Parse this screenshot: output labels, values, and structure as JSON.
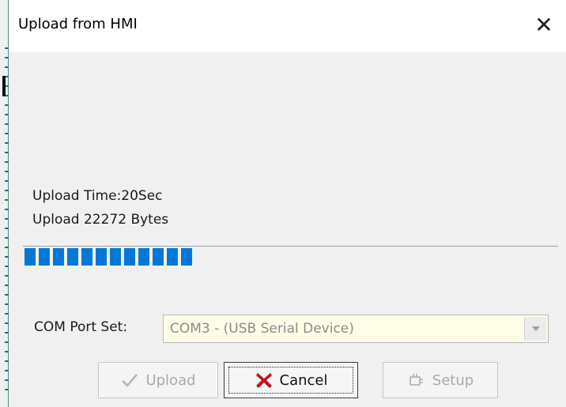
{
  "window": {
    "title": "Upload from HMI",
    "close_glyph": "✕"
  },
  "status": {
    "upload_time": "Upload Time:20Sec",
    "upload_bytes": "Upload 22272 Bytes"
  },
  "progress": {
    "fraction": 0.32,
    "color": "#0078d7"
  },
  "com_port": {
    "label": "COM Port Set:",
    "selected": "COM3 - (USB Serial Device)"
  },
  "buttons": {
    "upload": {
      "label": "Upload",
      "icon": "check-icon",
      "enabled": false
    },
    "cancel": {
      "label": "Cancel",
      "icon": "red-x-icon",
      "enabled": true
    },
    "setup": {
      "label": "Setup",
      "icon": "connector-icon",
      "enabled": false
    }
  },
  "colors": {
    "cancel_icon": "#c0141c",
    "disabled_text": "#aaaaaa"
  }
}
